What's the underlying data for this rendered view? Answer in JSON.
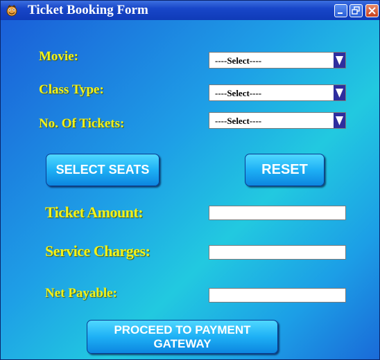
{
  "window": {
    "title": "Ticket Booking Form",
    "app_icon": "app-mascot-icon",
    "controls": [
      "minimize-icon",
      "restore-icon",
      "close-icon"
    ]
  },
  "form": {
    "movie": {
      "label": "Movie:",
      "selected": "----Select----"
    },
    "class_type": {
      "label": "Class Type:",
      "selected": "----Select----"
    },
    "tickets": {
      "label": "No. Of Tickets:",
      "selected": "----Select----"
    },
    "select_seats_button": "SELECT SEATS",
    "reset_button": "RESET",
    "ticket_amount": {
      "label": "Ticket Amount:",
      "value": ""
    },
    "service_charges": {
      "label": "Service Charges:",
      "value": ""
    },
    "net_payable": {
      "label": "Net Payable:",
      "value": ""
    },
    "payment_button": "PROCEED TO PAYMENT GATEWAY"
  },
  "colors": {
    "label_text": "#f2f21a",
    "titlebar": "#1846c8",
    "dropdown_arrow": "#2e2e9e",
    "button_face": "#1eb0f5"
  }
}
